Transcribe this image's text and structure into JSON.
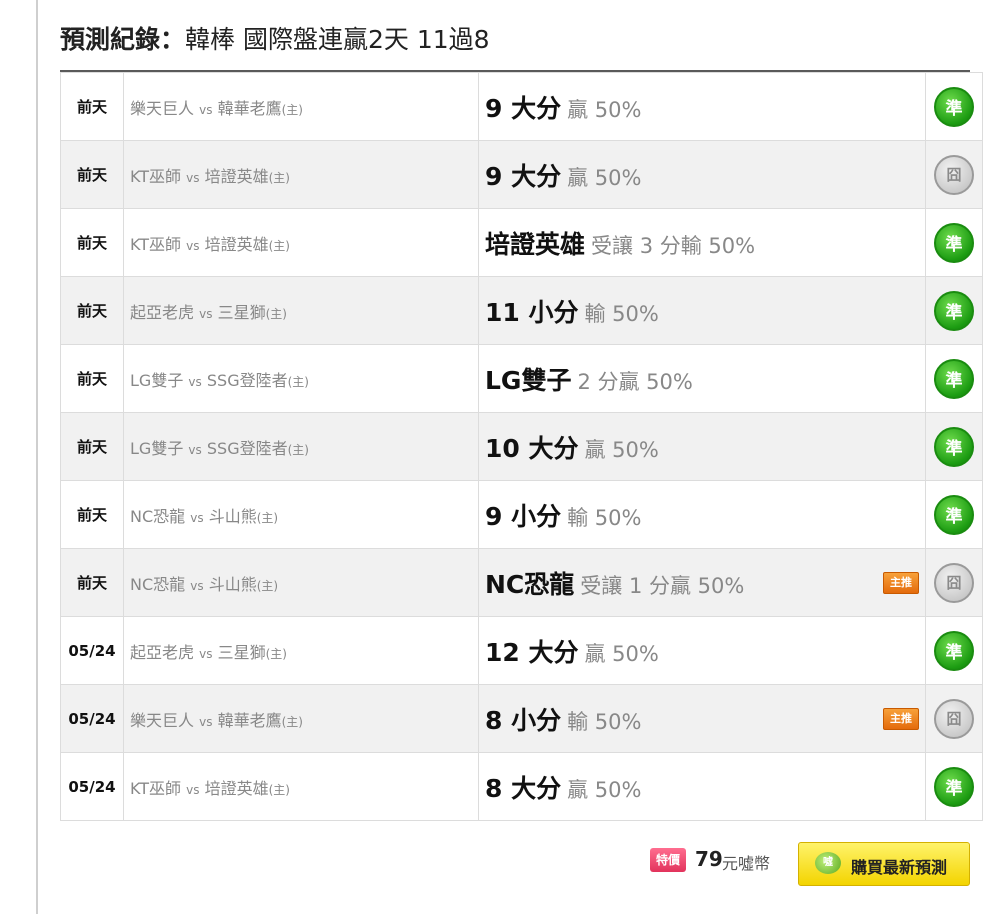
{
  "header": {
    "title_bold": "預測紀錄：",
    "title_rest": "韓棒 國際盤連贏2天 11過8"
  },
  "records": [
    {
      "date": "前天",
      "away": "樂天巨人",
      "vs": "vs",
      "home": "韓華老鷹",
      "home_mark": "(主)",
      "pick": "9 大分",
      "detail": "贏 50%",
      "master": false,
      "result": "準",
      "hit": true
    },
    {
      "date": "前天",
      "away": "KT巫師",
      "vs": "vs",
      "home": "培證英雄",
      "home_mark": "(主)",
      "pick": "9 大分",
      "detail": "贏 50%",
      "master": false,
      "result": "囧",
      "hit": false
    },
    {
      "date": "前天",
      "away": "KT巫師",
      "vs": "vs",
      "home": "培證英雄",
      "home_mark": "(主)",
      "pick": "培證英雄",
      "detail": "受讓 3 分輸 50%",
      "master": false,
      "result": "準",
      "hit": true
    },
    {
      "date": "前天",
      "away": "起亞老虎",
      "vs": "vs",
      "home": "三星獅",
      "home_mark": "(主)",
      "pick": "11 小分",
      "detail": "輸 50%",
      "master": false,
      "result": "準",
      "hit": true
    },
    {
      "date": "前天",
      "away": "LG雙子",
      "vs": "vs",
      "home": "SSG登陸者",
      "home_mark": "(主)",
      "pick": "LG雙子",
      "detail": "2 分贏 50%",
      "master": false,
      "result": "準",
      "hit": true
    },
    {
      "date": "前天",
      "away": "LG雙子",
      "vs": "vs",
      "home": "SSG登陸者",
      "home_mark": "(主)",
      "pick": "10 大分",
      "detail": "贏 50%",
      "master": false,
      "result": "準",
      "hit": true
    },
    {
      "date": "前天",
      "away": "NC恐龍",
      "vs": "vs",
      "home": "斗山熊",
      "home_mark": "(主)",
      "pick": "9 小分",
      "detail": "輸 50%",
      "master": false,
      "result": "準",
      "hit": true
    },
    {
      "date": "前天",
      "away": "NC恐龍",
      "vs": "vs",
      "home": "斗山熊",
      "home_mark": "(主)",
      "pick": "NC恐龍",
      "detail": "受讓 1 分贏 50%",
      "master": true,
      "result": "囧",
      "hit": false
    },
    {
      "date": "05/24",
      "away": "起亞老虎",
      "vs": "vs",
      "home": "三星獅",
      "home_mark": "(主)",
      "pick": "12 大分",
      "detail": "贏 50%",
      "master": false,
      "result": "準",
      "hit": true
    },
    {
      "date": "05/24",
      "away": "樂天巨人",
      "vs": "vs",
      "home": "韓華老鷹",
      "home_mark": "(主)",
      "pick": "8 小分",
      "detail": "輸 50%",
      "master": true,
      "result": "囧",
      "hit": false
    },
    {
      "date": "05/24",
      "away": "KT巫師",
      "vs": "vs",
      "home": "培證英雄",
      "home_mark": "(主)",
      "pick": "8 大分",
      "detail": "贏 50%",
      "master": false,
      "result": "準",
      "hit": true
    }
  ],
  "master_badge_label": "主推",
  "footer": {
    "sale_badge": "特價",
    "price": "79",
    "price_unit": "元噓幣",
    "buy_icon": "噓",
    "buy_label": "購買最新預測"
  },
  "colors": {
    "hit": "#1c9c12",
    "miss": "#c8c8c8",
    "buy_button": "#f3d400",
    "master_badge": "#e46b0c",
    "sale_badge": "#e2335c"
  }
}
